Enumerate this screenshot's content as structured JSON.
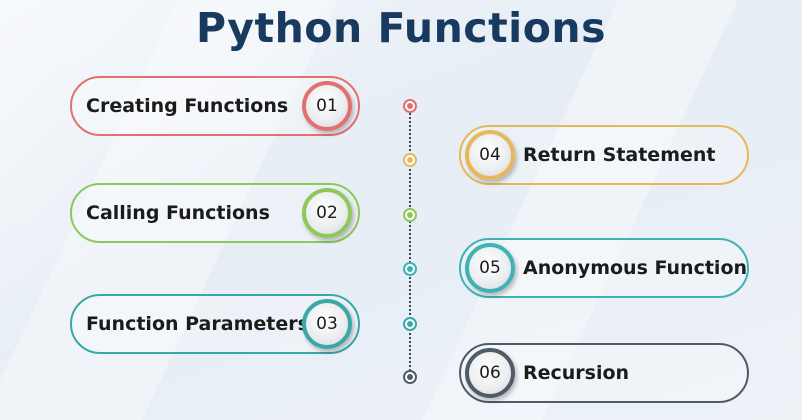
{
  "title": "Python Functions",
  "colors": {
    "title": "#173a5e",
    "red": "#e3706f",
    "yellow": "#e6b859",
    "green": "#8fc85a",
    "teal": "#3fb2b5",
    "teal_dark": "#39a8a6",
    "slate": "#4f5b66"
  },
  "items": [
    {
      "number": "01",
      "label": "Creating Functions",
      "color": "#e3706f",
      "side": "left"
    },
    {
      "number": "02",
      "label": "Calling Functions",
      "color": "#8fc85a",
      "side": "left"
    },
    {
      "number": "03",
      "label": "Function Parameters",
      "color": "#39a8a6",
      "side": "left"
    },
    {
      "number": "04",
      "label": "Return Statement",
      "color": "#e6b859",
      "side": "right"
    },
    {
      "number": "05",
      "label": "Anonymous Function",
      "color": "#3fb2b5",
      "side": "right"
    },
    {
      "number": "06",
      "label": "Recursion",
      "color": "#4f5b66",
      "side": "right"
    }
  ],
  "timeline_dots": [
    {
      "color": "#e3706f"
    },
    {
      "color": "#e6b859"
    },
    {
      "color": "#8fc85a"
    },
    {
      "color": "#3fb2b5"
    },
    {
      "color": "#39a8a6"
    },
    {
      "color": "#4f5b66"
    }
  ]
}
